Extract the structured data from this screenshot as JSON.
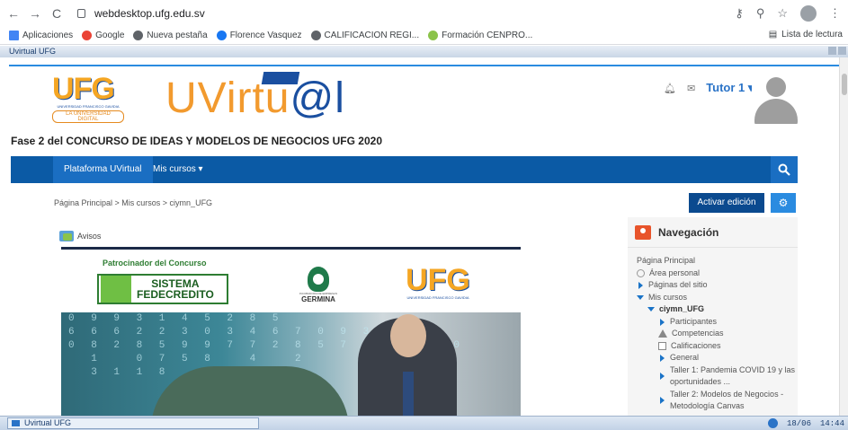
{
  "browser": {
    "back": "←",
    "forward": "→",
    "reload": "C",
    "url": "webdesktop.ufg.edu.sv",
    "bookmarks": [
      {
        "label": "Aplicaciones",
        "color": "#4285f4"
      },
      {
        "label": "Google",
        "color": "#ea4335"
      },
      {
        "label": "Nueva pestaña",
        "color": "#5f6368"
      },
      {
        "label": "Florence Vasquez",
        "color": "#1877f2"
      },
      {
        "label": "CALIFICACION REGI...",
        "color": "#5f6368"
      },
      {
        "label": "Formación CENPRO...",
        "color": "#8bc34a"
      }
    ],
    "reading_list": "Lista de lectura"
  },
  "window": {
    "title": "Uvirtual UFG"
  },
  "header": {
    "logo_letters": "UFG",
    "logo_sub": "UNIVERSIDAD FRANCISCO GAVIDIA",
    "logo_tag": "LA UNIVERSIDAD DIGITAL",
    "uvirtual_main": "UVirtu",
    "uvirtual_at": "@l",
    "page_title": "Fase 2 del CONCURSO DE IDEAS Y MODELOS DE NEGOCIOS UFG 2020",
    "user_name": "Tutor 1",
    "user_caret": "▾"
  },
  "navbar": {
    "home": "Plataforma UVirtual",
    "courses": "Mis cursos ▾",
    "search_icon": "🔍"
  },
  "breadcrumb": "Página Principal > Mis cursos > ciymn_UFG",
  "actions": {
    "edit": "Activar edición",
    "gear": "⚙"
  },
  "content": {
    "avisos": "Avisos",
    "sponsor_label": "Patrocinador del Concurso",
    "sistema_line1": "SISTEMA",
    "sistema_line2": "FEDECREDITO",
    "germina": "GERMINA",
    "germina_sub": "INCUBADORA DE EMPRESAS",
    "ufg_small": "UFG",
    "ufg_small_sub": "UNIVERSIDAD FRANCISCO GAVIDIA",
    "digits": "0 9 9 3 1 4 5 2 8 5\n6 6 6 2 2 3 0 3 4 6 7 0 9 3 3 4\n0 8 2 8 5 9 9 7 7 2 8 5 7 9 3   9 0\n  1   0 7 5 8   4   2     7 5 0 8\n  3 1 1 8"
  },
  "sidebar": {
    "title": "Navegación",
    "items": [
      {
        "label": "Página Principal"
      },
      {
        "label": "Área personal"
      },
      {
        "label": "Páginas del sitio"
      },
      {
        "label": "Mis cursos"
      },
      {
        "label": "ciymn_UFG"
      },
      {
        "label": "Participantes"
      },
      {
        "label": "Competencias"
      },
      {
        "label": "Calificaciones"
      },
      {
        "label": "General"
      },
      {
        "label": "Taller 1: Pandemia COVID 19 y las oportunidades ..."
      },
      {
        "label": "Taller 2: Modelos de Negocios - Metodología Canvas"
      }
    ]
  },
  "taskbar": {
    "item": "Uvirtual UFG",
    "date": "18/06",
    "time": "14:44"
  }
}
